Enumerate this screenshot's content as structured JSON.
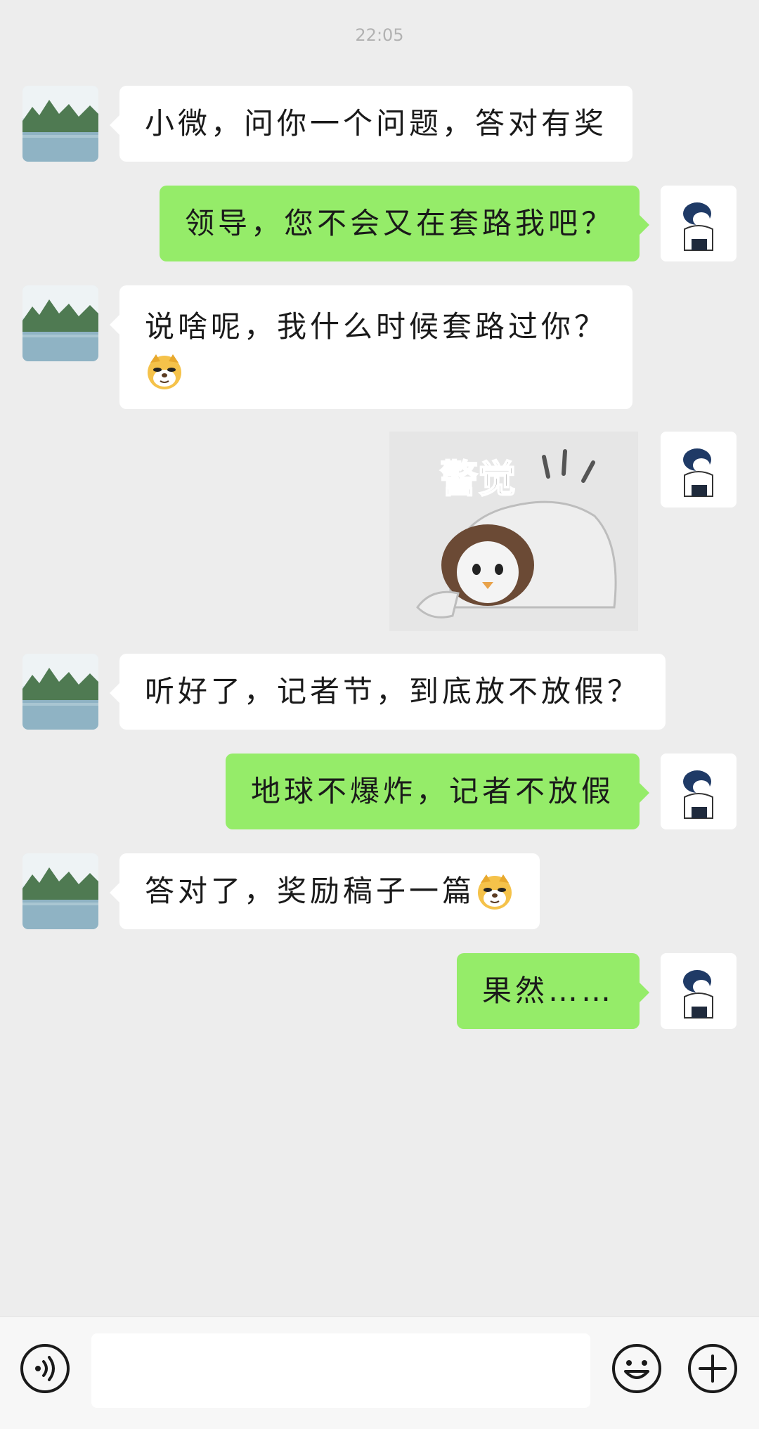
{
  "chat": {
    "timestamp": "22:05",
    "messages": [
      {
        "side": "left",
        "text": "小微，问你一个问题，答对有奖"
      },
      {
        "side": "right",
        "text": "领导，您不会又在套路我吧？"
      },
      {
        "side": "left",
        "text": "说啥呢，我什么时候套路过你？",
        "emoji": "doge-emoji"
      },
      {
        "side": "right",
        "sticker_text": "警觉"
      },
      {
        "side": "left",
        "text": "听好了，记者节，到底放不放假？"
      },
      {
        "side": "right",
        "text": "地球不爆炸，记者不放假"
      },
      {
        "side": "left",
        "text": "答对了，奖励稿子一篇",
        "emoji": "doge-emoji"
      },
      {
        "side": "right",
        "text": "果然……"
      }
    ]
  },
  "input_bar": {
    "voice_icon": "voice-icon",
    "emoji_icon": "smiley-icon",
    "plus_icon": "plus-icon"
  },
  "colors": {
    "background": "#ededed",
    "self_bubble": "#95ec69",
    "other_bubble": "#ffffff"
  }
}
